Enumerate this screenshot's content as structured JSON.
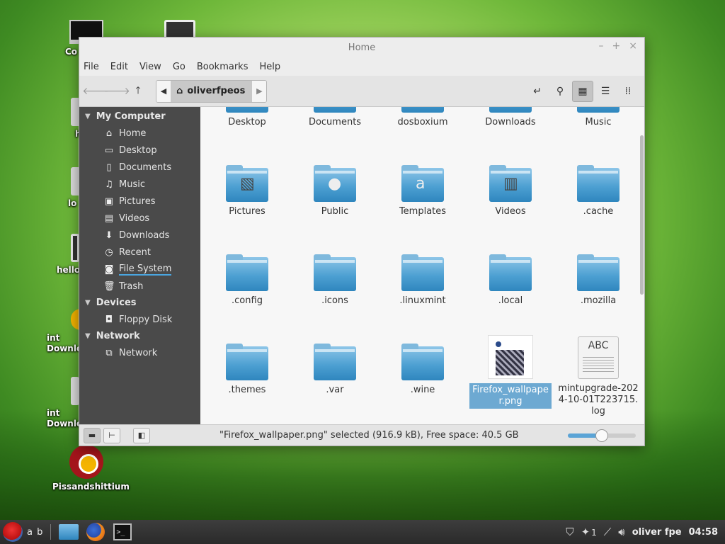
{
  "desktop": {
    "icons": [
      {
        "label": "Co"
      },
      {
        "label": "h"
      },
      {
        "label": "lo"
      },
      {
        "label": "hello"
      },
      {
        "label": "int\nDownlo"
      },
      {
        "label": "int\nDownlo"
      },
      {
        "label": "Pissandshittium"
      }
    ]
  },
  "window": {
    "title": "Home",
    "controls": {
      "minimize": "–",
      "maximize": "+",
      "close": "×"
    }
  },
  "menubar": [
    "File",
    "Edit",
    "View",
    "Go",
    "Bookmarks",
    "Help"
  ],
  "toolbar": {
    "path_crumb": "oliverfpeos"
  },
  "sidebar": {
    "sections": [
      {
        "title": "My Computer",
        "items": [
          {
            "label": "Home",
            "icon": "home-icon"
          },
          {
            "label": "Desktop",
            "icon": "desktop-icon"
          },
          {
            "label": "Documents",
            "icon": "documents-icon"
          },
          {
            "label": "Music",
            "icon": "music-icon"
          },
          {
            "label": "Pictures",
            "icon": "pictures-icon"
          },
          {
            "label": "Videos",
            "icon": "videos-icon"
          },
          {
            "label": "Downloads",
            "icon": "downloads-icon"
          },
          {
            "label": "Recent",
            "icon": "recent-icon"
          },
          {
            "label": "File System",
            "icon": "filesystem-icon"
          },
          {
            "label": "Trash",
            "icon": "trash-icon"
          }
        ]
      },
      {
        "title": "Devices",
        "items": [
          {
            "label": "Floppy Disk",
            "icon": "floppy-icon"
          }
        ]
      },
      {
        "title": "Network",
        "items": [
          {
            "label": "Network",
            "icon": "network-icon"
          }
        ]
      }
    ]
  },
  "files": [
    {
      "name": "Desktop",
      "type": "folder"
    },
    {
      "name": "Documents",
      "type": "folder"
    },
    {
      "name": "dosboxium",
      "type": "folder"
    },
    {
      "name": "Downloads",
      "type": "folder"
    },
    {
      "name": "Music",
      "type": "folder"
    },
    {
      "name": "Pictures",
      "type": "folder"
    },
    {
      "name": "Public",
      "type": "folder"
    },
    {
      "name": "Templates",
      "type": "folder"
    },
    {
      "name": "Videos",
      "type": "folder"
    },
    {
      "name": ".cache",
      "type": "folder"
    },
    {
      "name": ".config",
      "type": "folder"
    },
    {
      "name": ".icons",
      "type": "folder"
    },
    {
      "name": ".linuxmint",
      "type": "folder"
    },
    {
      "name": ".local",
      "type": "folder"
    },
    {
      "name": ".mozilla",
      "type": "folder"
    },
    {
      "name": ".themes",
      "type": "folder"
    },
    {
      "name": ".var",
      "type": "folder"
    },
    {
      "name": ".wine",
      "type": "folder"
    },
    {
      "name": "Firefox_wallpaper.png",
      "type": "image",
      "selected": true
    },
    {
      "name": "mintupgrade-2024-10-01T223715.log",
      "type": "text"
    }
  ],
  "statusbar": {
    "text": "\"Firefox_wallpaper.png\" selected (916.9 kB), Free space: 40.5 GB",
    "zoom_fraction": 0.5
  },
  "taskbar": {
    "menu_label": "a b",
    "tray": {
      "notification_count": "1",
      "user": "oliver fpe",
      "clock": "04:58"
    }
  }
}
